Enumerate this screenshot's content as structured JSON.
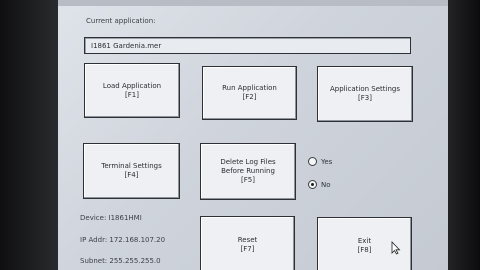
{
  "current_app_label": "Current application:",
  "current_app_value": "I1861 Gardenia.mer",
  "buttons": {
    "load": {
      "line1": "Load Application",
      "line2": "[F1]"
    },
    "run": {
      "line1": "Run Application",
      "line2": "[F2]"
    },
    "settings": {
      "line1": "Application Settings",
      "line2": "[F3]"
    },
    "terminal": {
      "line1": "Terminal Settings",
      "line2": "[F4]"
    },
    "delete_logs": {
      "line1": "Delete Log Files",
      "line2": "Before Running",
      "line3": "[F5]"
    },
    "reset": {
      "line1": "Reset",
      "line2": "[F7]"
    },
    "exit": {
      "line1": "Exit",
      "line2": "[F8]"
    }
  },
  "radio": {
    "yes_label": "Yes",
    "no_label": "No",
    "selected": "No"
  },
  "device_info": {
    "device": "Device: I1861HMI",
    "ip": "IP Addr: 172.168.107.20",
    "subnet": "Subnet: 255.255.255.0"
  }
}
